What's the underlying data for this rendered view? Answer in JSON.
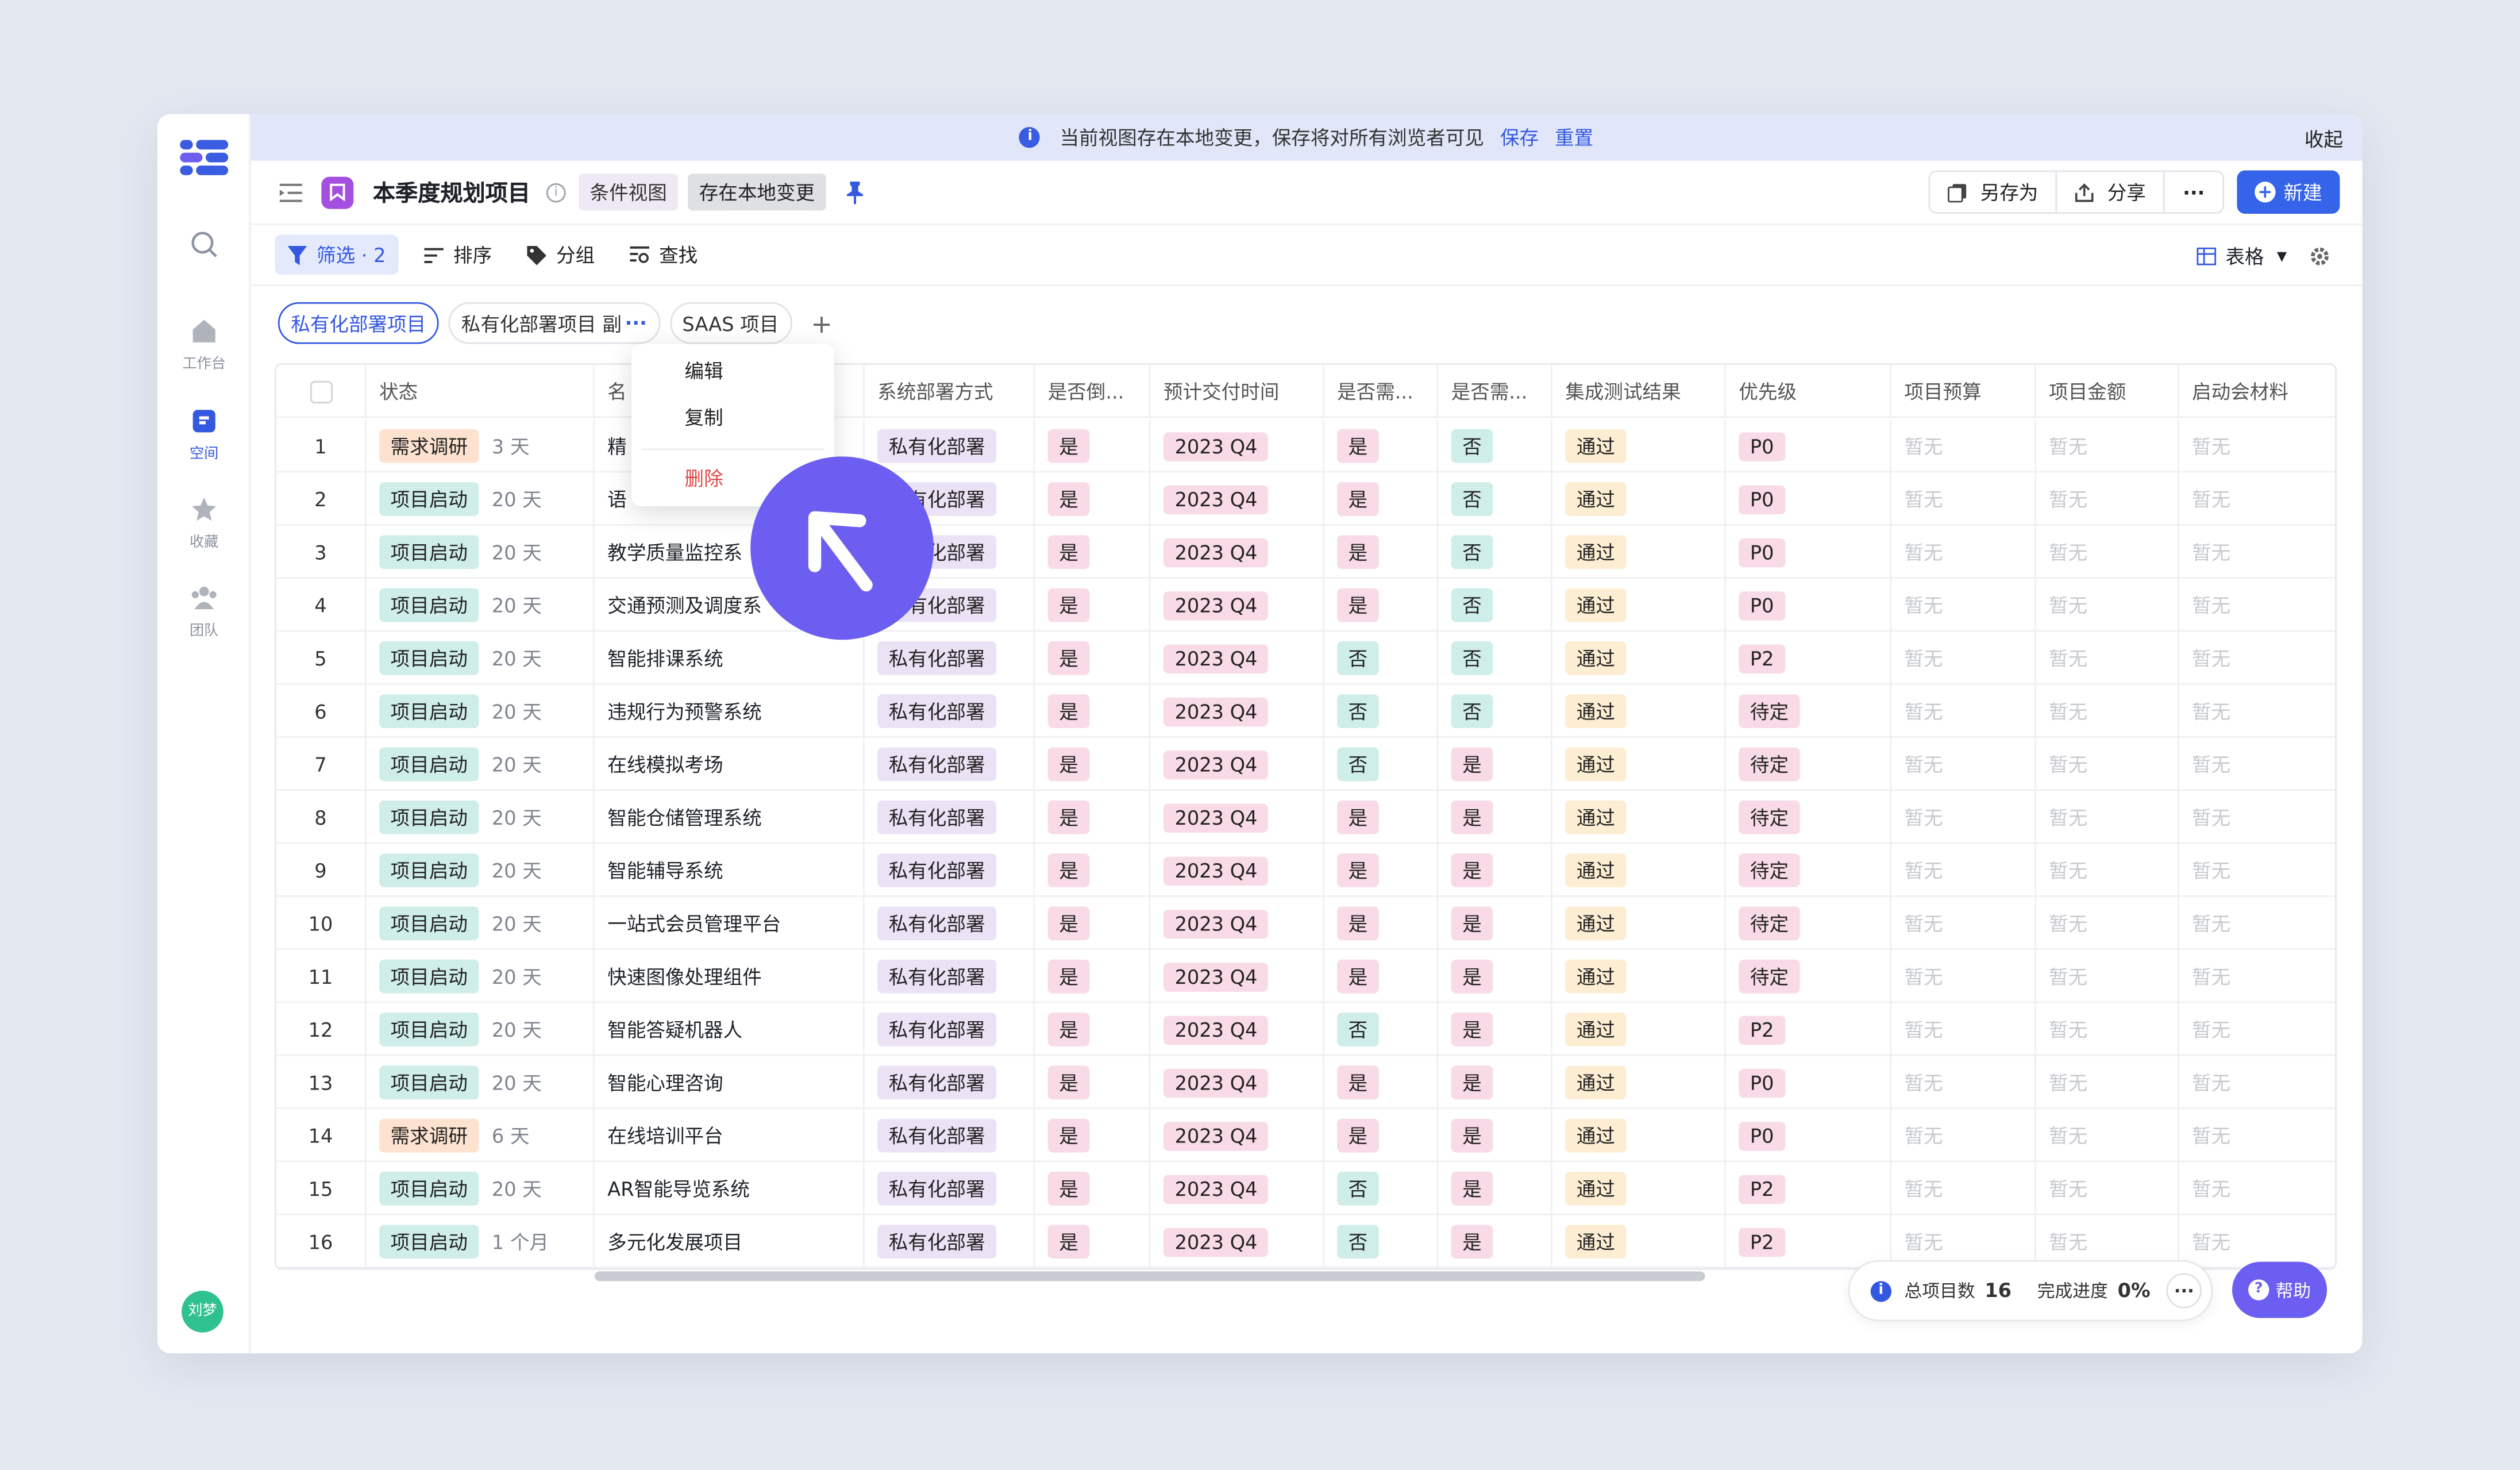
{
  "sidebar": {
    "items": [
      {
        "label": "工作台",
        "icon": "home-icon"
      },
      {
        "label": "空间",
        "icon": "space-icon"
      },
      {
        "label": "收藏",
        "icon": "star-icon"
      },
      {
        "label": "团队",
        "icon": "team-icon"
      }
    ],
    "user_initials": "刘梦"
  },
  "notice": {
    "text": "当前视图存在本地变更，保存将对所有浏览者可见",
    "save": "保存",
    "reset": "重置",
    "collapse": "收起"
  },
  "header": {
    "title": "本季度规划项目",
    "chip_view": "条件视图",
    "chip_local": "存在本地变更",
    "save_as": "另存为",
    "share": "分享",
    "more": "···",
    "new_btn": "新建"
  },
  "toolbar": {
    "filter": "筛选 · 2",
    "sort": "排序",
    "group": "分组",
    "search": "查找",
    "view_type": "表格"
  },
  "tabs": [
    "私有化部署项目",
    "私有化部署项目 副",
    "SAAS 项目"
  ],
  "tab_more": "···",
  "tab_add": "+",
  "table": {
    "columns": [
      "状态",
      "名",
      "系统部署方式",
      "是否倒...",
      "预计交付时间",
      "是否需...",
      "是否需...",
      "集成测试结果",
      "优先级",
      "项目预算",
      "项目金额",
      "启动会材料"
    ],
    "rows": [
      {
        "n": "1",
        "status": "需求调研",
        "days": "3 天",
        "name": "精",
        "deploy": "私有化部署",
        "c3": "是",
        "delivery": "2023 Q4",
        "c5": "是",
        "c6": "否",
        "test": "通过",
        "prio": "P0",
        "b1": "暂无",
        "b2": "暂无",
        "b3": "暂无"
      },
      {
        "n": "2",
        "status": "项目启动",
        "days": "20 天",
        "name": "语",
        "deploy": "私有化部署",
        "c3": "是",
        "delivery": "2023 Q4",
        "c5": "是",
        "c6": "否",
        "test": "通过",
        "prio": "P0",
        "b1": "暂无",
        "b2": "暂无",
        "b3": "暂无"
      },
      {
        "n": "3",
        "status": "项目启动",
        "days": "20 天",
        "name": "教学质量监控系",
        "deploy": "私有化部署",
        "c3": "是",
        "delivery": "2023 Q4",
        "c5": "是",
        "c6": "否",
        "test": "通过",
        "prio": "P0",
        "b1": "暂无",
        "b2": "暂无",
        "b3": "暂无"
      },
      {
        "n": "4",
        "status": "项目启动",
        "days": "20 天",
        "name": "交通预测及调度系",
        "deploy": "私有化部署",
        "c3": "是",
        "delivery": "2023 Q4",
        "c5": "是",
        "c6": "否",
        "test": "通过",
        "prio": "P0",
        "b1": "暂无",
        "b2": "暂无",
        "b3": "暂无"
      },
      {
        "n": "5",
        "status": "项目启动",
        "days": "20 天",
        "name": "智能排课系统",
        "deploy": "私有化部署",
        "c3": "是",
        "delivery": "2023 Q4",
        "c5": "否",
        "c6": "否",
        "test": "通过",
        "prio": "P2",
        "b1": "暂无",
        "b2": "暂无",
        "b3": "暂无"
      },
      {
        "n": "6",
        "status": "项目启动",
        "days": "20 天",
        "name": "违规行为预警系统",
        "deploy": "私有化部署",
        "c3": "是",
        "delivery": "2023 Q4",
        "c5": "否",
        "c6": "否",
        "test": "通过",
        "prio": "待定",
        "b1": "暂无",
        "b2": "暂无",
        "b3": "暂无"
      },
      {
        "n": "7",
        "status": "项目启动",
        "days": "20 天",
        "name": "在线模拟考场",
        "deploy": "私有化部署",
        "c3": "是",
        "delivery": "2023 Q4",
        "c5": "否",
        "c6": "是",
        "test": "通过",
        "prio": "待定",
        "b1": "暂无",
        "b2": "暂无",
        "b3": "暂无"
      },
      {
        "n": "8",
        "status": "项目启动",
        "days": "20 天",
        "name": "智能仓储管理系统",
        "deploy": "私有化部署",
        "c3": "是",
        "delivery": "2023 Q4",
        "c5": "是",
        "c6": "是",
        "test": "通过",
        "prio": "待定",
        "b1": "暂无",
        "b2": "暂无",
        "b3": "暂无"
      },
      {
        "n": "9",
        "status": "项目启动",
        "days": "20 天",
        "name": "智能辅导系统",
        "deploy": "私有化部署",
        "c3": "是",
        "delivery": "2023 Q4",
        "c5": "是",
        "c6": "是",
        "test": "通过",
        "prio": "待定",
        "b1": "暂无",
        "b2": "暂无",
        "b3": "暂无"
      },
      {
        "n": "10",
        "status": "项目启动",
        "days": "20 天",
        "name": "一站式会员管理平台",
        "deploy": "私有化部署",
        "c3": "是",
        "delivery": "2023 Q4",
        "c5": "是",
        "c6": "是",
        "test": "通过",
        "prio": "待定",
        "b1": "暂无",
        "b2": "暂无",
        "b3": "暂无"
      },
      {
        "n": "11",
        "status": "项目启动",
        "days": "20 天",
        "name": "快速图像处理组件",
        "deploy": "私有化部署",
        "c3": "是",
        "delivery": "2023 Q4",
        "c5": "是",
        "c6": "是",
        "test": "通过",
        "prio": "待定",
        "b1": "暂无",
        "b2": "暂无",
        "b3": "暂无"
      },
      {
        "n": "12",
        "status": "项目启动",
        "days": "20 天",
        "name": "智能答疑机器人",
        "deploy": "私有化部署",
        "c3": "是",
        "delivery": "2023 Q4",
        "c5": "否",
        "c6": "是",
        "test": "通过",
        "prio": "P2",
        "b1": "暂无",
        "b2": "暂无",
        "b3": "暂无"
      },
      {
        "n": "13",
        "status": "项目启动",
        "days": "20 天",
        "name": "智能心理咨询",
        "deploy": "私有化部署",
        "c3": "是",
        "delivery": "2023 Q4",
        "c5": "是",
        "c6": "是",
        "test": "通过",
        "prio": "P0",
        "b1": "暂无",
        "b2": "暂无",
        "b3": "暂无"
      },
      {
        "n": "14",
        "status": "需求调研",
        "days": "6 天",
        "name": "在线培训平台",
        "deploy": "私有化部署",
        "c3": "是",
        "delivery": "2023 Q4",
        "c5": "是",
        "c6": "是",
        "test": "通过",
        "prio": "P0",
        "b1": "暂无",
        "b2": "暂无",
        "b3": "暂无"
      },
      {
        "n": "15",
        "status": "项目启动",
        "days": "20 天",
        "name": "AR智能导览系统",
        "deploy": "私有化部署",
        "c3": "是",
        "delivery": "2023 Q4",
        "c5": "否",
        "c6": "是",
        "test": "通过",
        "prio": "P2",
        "b1": "暂无",
        "b2": "暂无",
        "b3": "暂无"
      },
      {
        "n": "16",
        "status": "项目启动",
        "days": "1 个月",
        "name": "多元化发展项目",
        "deploy": "私有化部署",
        "c3": "是",
        "delivery": "2023 Q4",
        "c5": "否",
        "c6": "是",
        "test": "通过",
        "prio": "P2",
        "b1": "暂无",
        "b2": "暂无",
        "b3": "暂无"
      }
    ]
  },
  "context_menu": {
    "edit": "编辑",
    "copy": "复制",
    "delete": "删除"
  },
  "footer": {
    "total_label": "总项目数",
    "total_value": "16",
    "progress_label": "完成进度",
    "progress_value": "0%",
    "more": "···",
    "help": "帮助"
  },
  "colors": {
    "accent": "#3563e9",
    "cursor": "#6b5ef0",
    "tag_orange": "#fde3cf",
    "tag_teal": "#cfeeea",
    "tag_pink": "#f8dbe6"
  }
}
